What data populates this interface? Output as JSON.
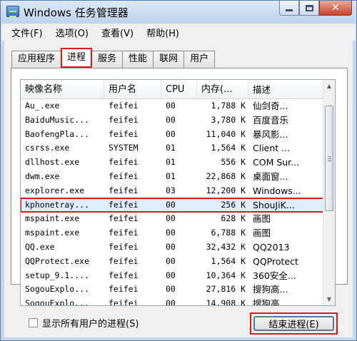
{
  "window": {
    "title": "Windows 任务管理器",
    "close_glyph": "✕"
  },
  "menu": [
    "文件(F)",
    "选项(O)",
    "查看(V)",
    "帮助(H)"
  ],
  "tabs": [
    {
      "label": "应用程序",
      "active": false
    },
    {
      "label": "进程",
      "active": true
    },
    {
      "label": "服务",
      "active": false
    },
    {
      "label": "性能",
      "active": false
    },
    {
      "label": "联网",
      "active": false
    },
    {
      "label": "用户",
      "active": false
    }
  ],
  "columns": {
    "name": "映像名称",
    "user": "用户名",
    "cpu": "CPU",
    "mem": "内存(...",
    "desc": "描述"
  },
  "processes": [
    {
      "name": "Au_.exe",
      "user": "feifei",
      "cpu": "00",
      "mem": "1,788 K",
      "desc": "仙剑奇..."
    },
    {
      "name": "BaiduMusic...",
      "user": "feifei",
      "cpu": "00",
      "mem": "3,780 K",
      "desc": "百度音乐"
    },
    {
      "name": "BaofengPla...",
      "user": "feifei",
      "cpu": "00",
      "mem": "11,040 K",
      "desc": "暴风影..."
    },
    {
      "name": "csrss.exe",
      "user": "SYSTEM",
      "cpu": "01",
      "mem": "1,564 K",
      "desc": "Client ..."
    },
    {
      "name": "dllhost.exe",
      "user": "feifei",
      "cpu": "01",
      "mem": "556 K",
      "desc": "COM Sur..."
    },
    {
      "name": "dwm.exe",
      "user": "feifei",
      "cpu": "01",
      "mem": "22,868 K",
      "desc": "桌面窗..."
    },
    {
      "name": "explorer.exe",
      "user": "feifei",
      "cpu": "03",
      "mem": "12,200 K",
      "desc": "Windows..."
    },
    {
      "name": "kphonetray...",
      "user": "feifei",
      "cpu": "00",
      "mem": "256 K",
      "desc": "ShouJiK...",
      "selected": true
    },
    {
      "name": "mspaint.exe",
      "user": "feifei",
      "cpu": "00",
      "mem": "628 K",
      "desc": "画图"
    },
    {
      "name": "mspaint.exe",
      "user": "feifei",
      "cpu": "00",
      "mem": "6,788 K",
      "desc": "画图"
    },
    {
      "name": "QQ.exe",
      "user": "feifei",
      "cpu": "00",
      "mem": "32,432 K",
      "desc": "QQ2013"
    },
    {
      "name": "QQProtect.exe",
      "user": "feifei",
      "cpu": "00",
      "mem": "1,564 K",
      "desc": "QQProtect"
    },
    {
      "name": "setup_9.1....",
      "user": "feifei",
      "cpu": "00",
      "mem": "10,364 K",
      "desc": "360安全..."
    },
    {
      "name": "SogouExplo...",
      "user": "feifei",
      "cpu": "00",
      "mem": "27,816 K",
      "desc": "搜狗高..."
    },
    {
      "name": "SogouExplo...",
      "user": "feifei",
      "cpu": "00",
      "mem": "14,908 K",
      "desc": "搜狗高..."
    }
  ],
  "show_all_users_label": "显示所有用户的进程(S)",
  "end_process_label": "结束进程(E)"
}
